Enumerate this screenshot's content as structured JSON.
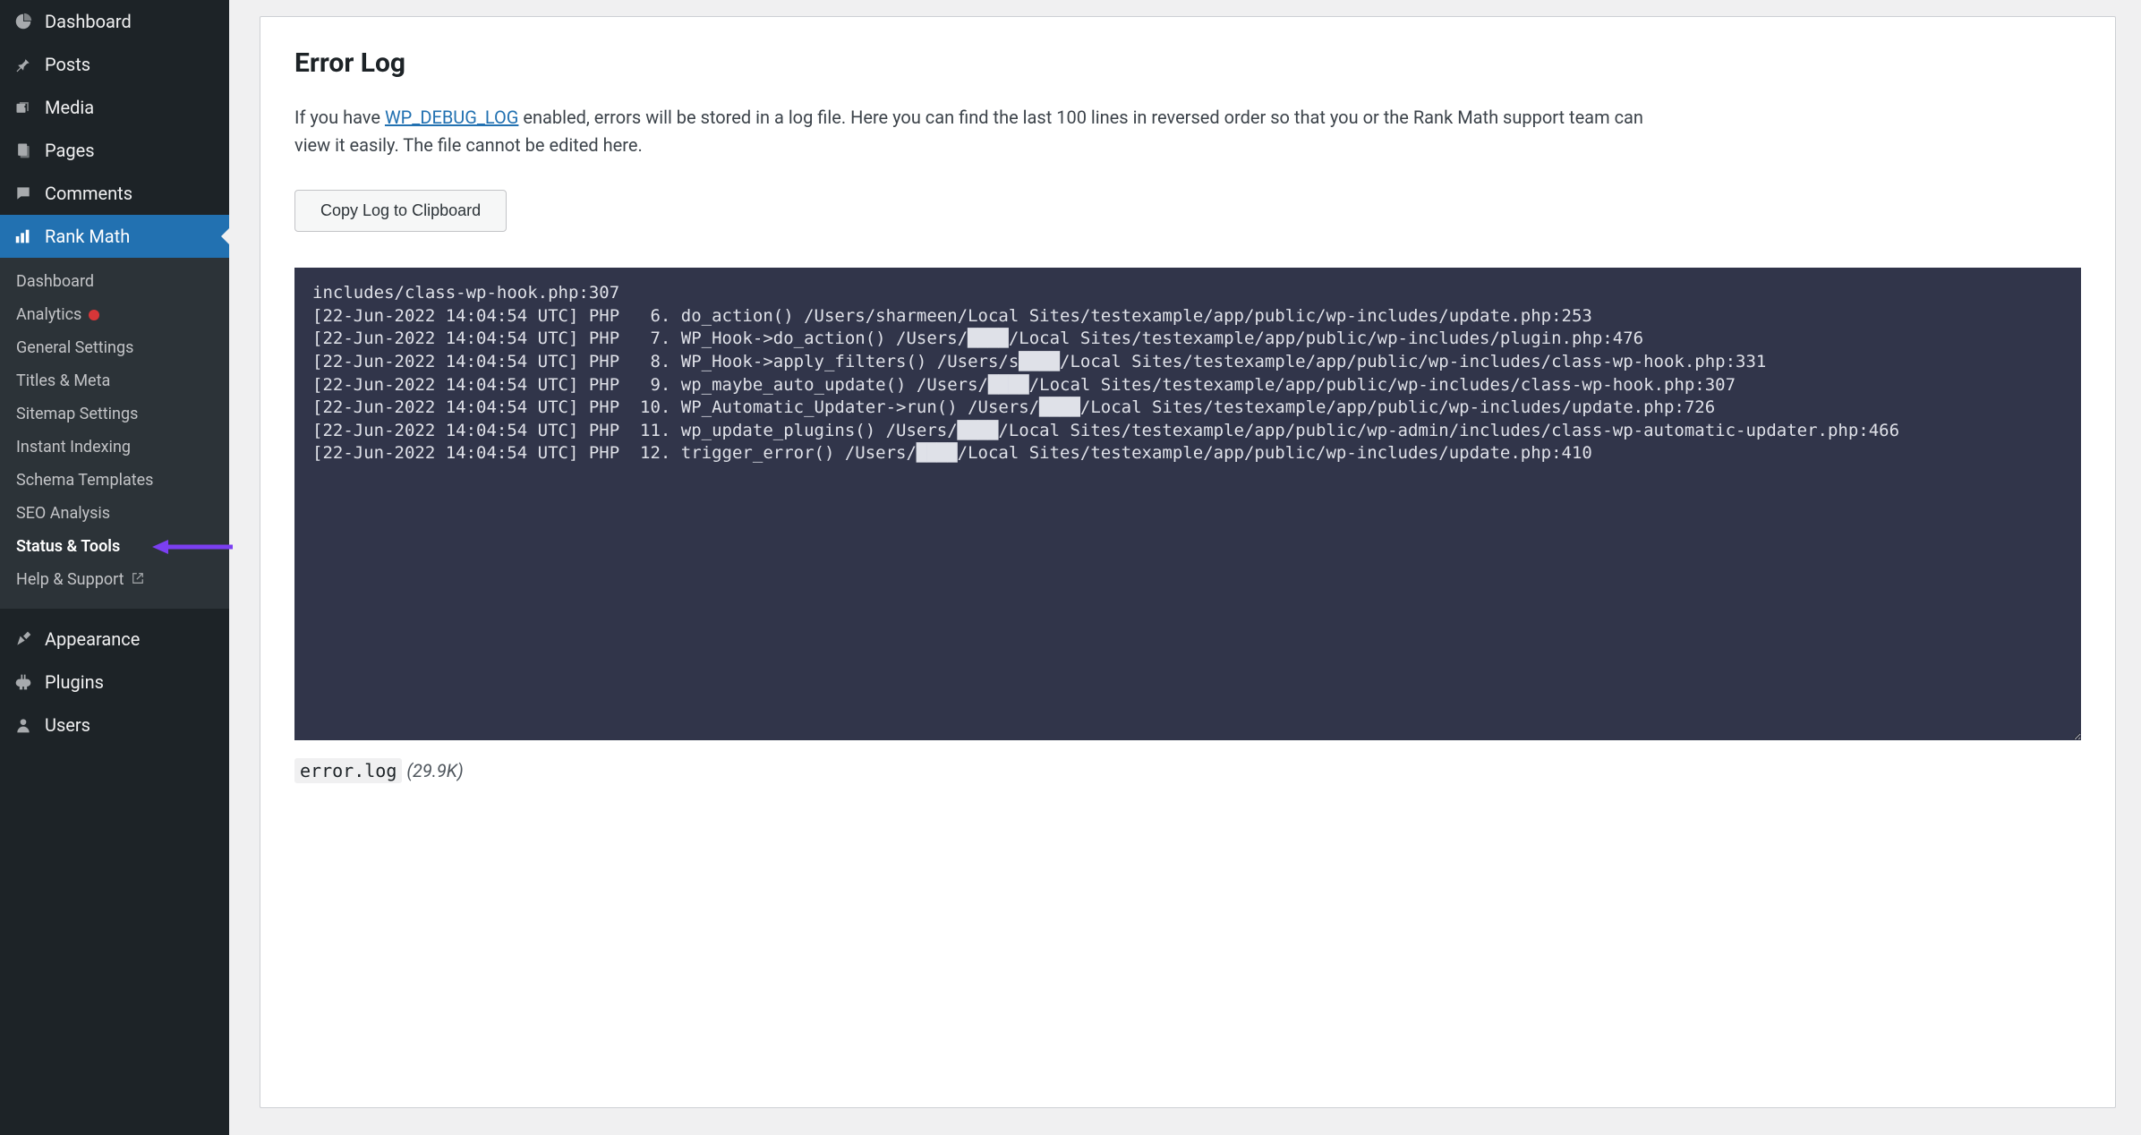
{
  "sidebar": {
    "items": [
      {
        "label": "Dashboard",
        "icon": "dashboard-icon"
      },
      {
        "label": "Posts",
        "icon": "pin-icon"
      },
      {
        "label": "Media",
        "icon": "media-icon"
      },
      {
        "label": "Pages",
        "icon": "pages-icon"
      },
      {
        "label": "Comments",
        "icon": "comments-icon"
      },
      {
        "label": "Rank Math",
        "icon": "rankmath-icon",
        "active": true
      },
      {
        "label": "Appearance",
        "icon": "appearance-icon"
      },
      {
        "label": "Plugins",
        "icon": "plugins-icon"
      },
      {
        "label": "Users",
        "icon": "users-icon"
      }
    ],
    "submenu": [
      {
        "label": "Dashboard"
      },
      {
        "label": "Analytics",
        "dot": true
      },
      {
        "label": "General Settings"
      },
      {
        "label": "Titles & Meta"
      },
      {
        "label": "Sitemap Settings"
      },
      {
        "label": "Instant Indexing"
      },
      {
        "label": "Schema Templates"
      },
      {
        "label": "SEO Analysis"
      },
      {
        "label": "Status & Tools",
        "current": true
      },
      {
        "label": "Help & Support",
        "external": true
      }
    ]
  },
  "page": {
    "title": "Error Log",
    "intro_before": "If you have ",
    "intro_link_label": "WP_DEBUG_LOG",
    "intro_after": " enabled, errors will be stored in a log file. Here you can find the last 100 lines in reversed order so that you or the Rank Math support team can view it easily. The file cannot be edited here.",
    "copy_button": "Copy Log to Clipboard",
    "log_text": "includes/class-wp-hook.php:307\n[22-Jun-2022 14:04:54 UTC] PHP   6. do_action() /Users/sharmeen/Local Sites/testexample/app/public/wp-includes/update.php:253\n[22-Jun-2022 14:04:54 UTC] PHP   7. WP_Hook->do_action() /Users/████/Local Sites/testexample/app/public/wp-includes/plugin.php:476\n[22-Jun-2022 14:04:54 UTC] PHP   8. WP_Hook->apply_filters() /Users/s████/Local Sites/testexample/app/public/wp-includes/class-wp-hook.php:331\n[22-Jun-2022 14:04:54 UTC] PHP   9. wp_maybe_auto_update() /Users/████/Local Sites/testexample/app/public/wp-includes/class-wp-hook.php:307\n[22-Jun-2022 14:04:54 UTC] PHP  10. WP_Automatic_Updater->run() /Users/████/Local Sites/testexample/app/public/wp-includes/update.php:726\n[22-Jun-2022 14:04:54 UTC] PHP  11. wp_update_plugins() /Users/████/Local Sites/testexample/app/public/wp-admin/includes/class-wp-automatic-updater.php:466\n[22-Jun-2022 14:04:54 UTC] PHP  12. trigger_error() /Users/████/Local Sites/testexample/app/public/wp-includes/update.php:410",
    "file_name": "error.log",
    "file_size": "(29.9K)"
  }
}
